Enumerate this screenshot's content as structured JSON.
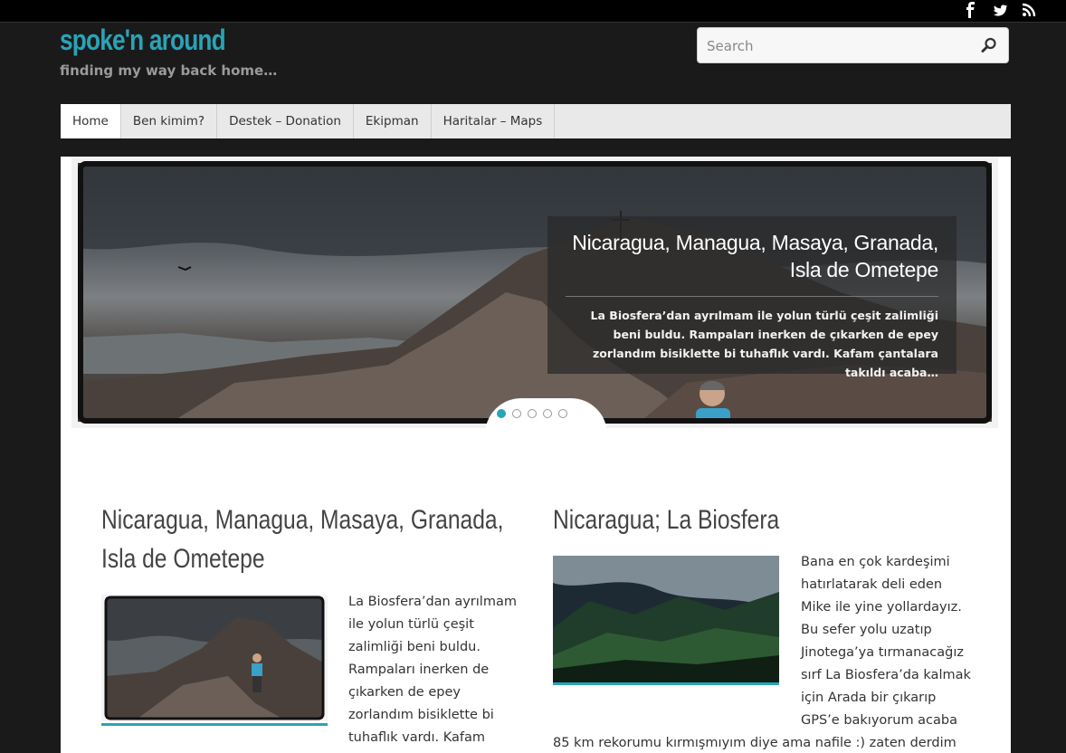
{
  "site": {
    "title": "spoke'n around",
    "tagline": "finding my way back home…"
  },
  "social": [
    "facebook-icon",
    "twitter-icon",
    "rss-icon"
  ],
  "search": {
    "placeholder": "Search"
  },
  "nav": {
    "items": [
      {
        "label": "Home",
        "active": true
      },
      {
        "label": "Ben kimim?"
      },
      {
        "label": "Destek – Donation"
      },
      {
        "label": "Ekipman"
      },
      {
        "label": "Haritalar – Maps"
      }
    ]
  },
  "slider": {
    "title": "Nicaragua, Managua, Masaya, Granada, Isla de Ometepe",
    "excerpt": "La Biosfera’dan ayrılmam ile yolun türlü çeşit zalimliği beni buldu. Rampaları inerken de çıkarken de epey zorlandım bisiklette bi tuhaflık vardı. Kafam çantalara takıldı acaba…",
    "dots": 5,
    "active_dot": 1
  },
  "posts": [
    {
      "title": "Nicaragua, Managua, Masaya, Granada, Isla de Ometepe",
      "excerpt": "La Biosfera’dan ayrılmam ile yolun türlü çeşit zalimliği beni buldu. Rampaları inerken de çıkarken de epey zorlandım bisiklette bi tuhaflık vardı. Kafam çantalara takıldı"
    },
    {
      "title": "Nicaragua; La Biosfera",
      "excerpt": "Bana en çok kardeşimi hatırlatarak deli eden Mike ile yine yollardayız. Bu sefer yolu uzatıp Jinotega’ya tırmanacağız sırf La Biosfera’da kalmak için   Arada bir çıkarıp GPS’e bakıyorum acaba 85 km rekorumu kırmışmıyım diye ama nafile :) zaten derdim de hız yapmak değil. Bu arada inişler bitti"
    }
  ],
  "colors": {
    "accent": "#2aa3b6",
    "background": "#1a1a1a",
    "nav": "#e9e9e9"
  }
}
